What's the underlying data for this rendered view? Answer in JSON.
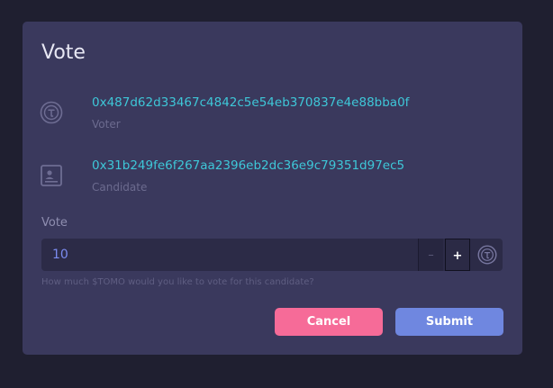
{
  "modal": {
    "title": "Vote",
    "voter": {
      "address": "0x487d62d33467c4842c5e54eb370837e4e88bba0f",
      "label": "Voter",
      "icon": "tomo-coin-icon"
    },
    "candidate": {
      "address": "0x31b249fe6f267aa2396eb2dc36e9c79351d97ec5",
      "label": "Candidate",
      "icon": "id-card-icon"
    },
    "vote_field": {
      "label": "Vote",
      "value": "10",
      "minus_label": "–",
      "plus_label": "+",
      "unit_icon": "tomo-coin-icon",
      "helper": "How much $TOMO would you like to vote for this candidate?"
    },
    "buttons": {
      "cancel": "Cancel",
      "submit": "Submit"
    }
  },
  "colors": {
    "background": "#1f1f30",
    "modal": "#3a395d",
    "address": "#3ec7d8",
    "cancel": "#f66b98",
    "submit": "#6f87e0"
  }
}
